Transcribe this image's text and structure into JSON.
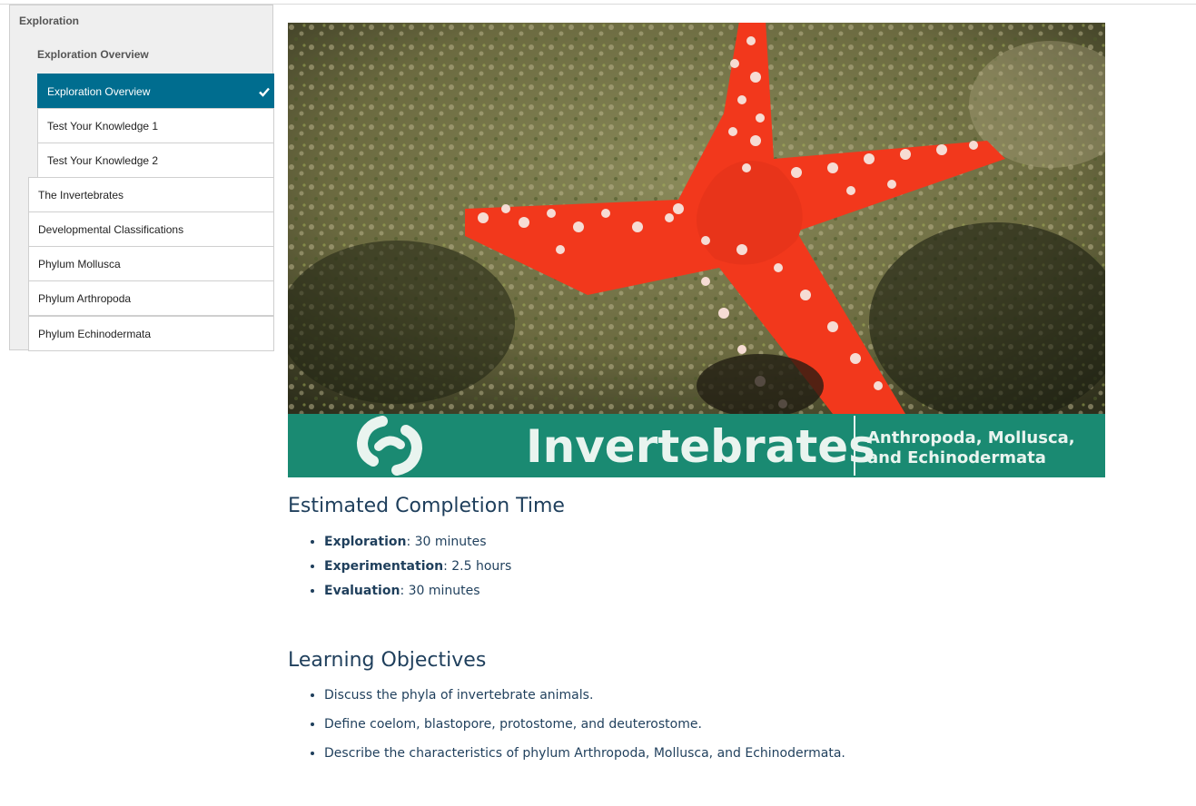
{
  "sidebar": {
    "section": "Exploration",
    "subsection": "Exploration Overview",
    "nested_items": [
      {
        "label": "Exploration Overview",
        "active": true
      },
      {
        "label": "Test Your Knowledge 1"
      },
      {
        "label": "Test Your Knowledge 2"
      }
    ],
    "items": [
      {
        "label": "The Invertebrates"
      },
      {
        "label": "Developmental Classifications"
      },
      {
        "label": "Phylum Mollusca"
      },
      {
        "label": "Phylum Arthropoda"
      },
      {
        "label": "Phylum Echinodermata"
      }
    ]
  },
  "hero": {
    "title": "Invertebrates",
    "subtitle": "Anthropoda, Mollusca, and Echinodermata",
    "banner_color": "#1a8a72",
    "starfish_color": "#f2381c",
    "logo_icon": "link-chain-logo"
  },
  "completion": {
    "heading": "Estimated Completion Time",
    "items": [
      {
        "label": "Exploration",
        "value": ": 30 minutes"
      },
      {
        "label": "Experimentation",
        "value": ": 2.5 hours"
      },
      {
        "label": "Evaluation",
        "value": ": 30 minutes"
      }
    ]
  },
  "objectives": {
    "heading": "Learning Objectives",
    "items": [
      "Discuss the phyla of invertebrate animals.",
      "Define coelom, blastopore, protostome, and deuterostome.",
      "Describe the characteristics of phylum Arthropoda, Mollusca, and Echinodermata."
    ]
  },
  "colors": {
    "active_nav": "#006d8f",
    "heading_text": "#1f3f5c"
  }
}
